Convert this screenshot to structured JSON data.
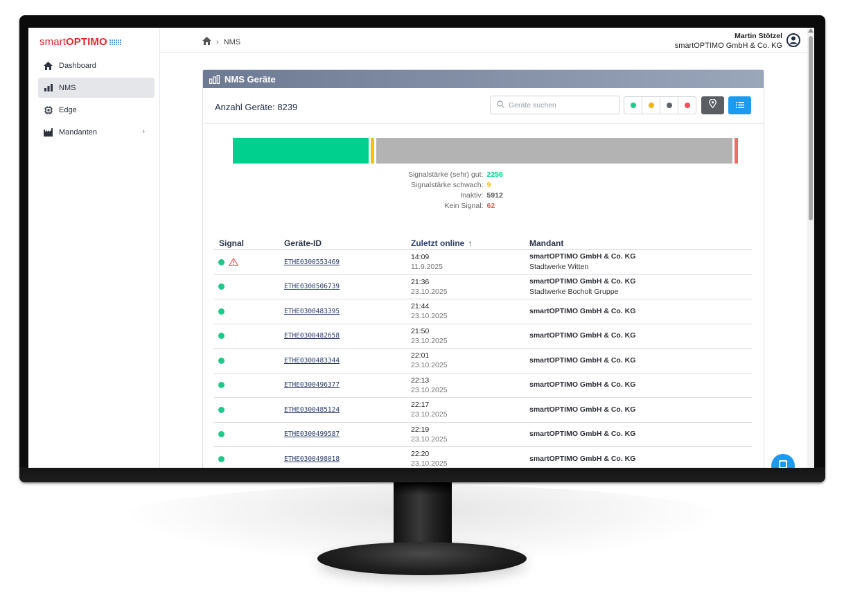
{
  "app": {
    "logo_smart": "smart",
    "logo_optimo": "OPTIMO",
    "brand_color": "#e3262a"
  },
  "sidebar": {
    "items": [
      {
        "label": "Dashboard",
        "icon": "home-icon",
        "active": false
      },
      {
        "label": "NMS",
        "icon": "bar-chart-icon",
        "active": true
      },
      {
        "label": "Edge",
        "icon": "chip-icon",
        "active": false
      },
      {
        "label": "Mandanten",
        "icon": "factory-icon",
        "active": false,
        "has_submenu": true
      }
    ]
  },
  "header": {
    "breadcrumb": [
      "NMS"
    ],
    "user_name": "Martin Stötzel",
    "user_org": "smartOPTIMO GmbH & Co. KG"
  },
  "card": {
    "title": "NMS Geräte",
    "count_label": "Anzahl Geräte: 8239",
    "search_placeholder": "Geräte suchen",
    "filter_colors": [
      "#1ec98a",
      "#f5b400",
      "#5f6368",
      "#f0505a"
    ]
  },
  "signal_summary": [
    {
      "label": "Signalstärke (sehr) gut:",
      "value": 2256,
      "color": "#00d08e"
    },
    {
      "label": "Signalstärke schwach:",
      "value": 9,
      "color": "#f5c000"
    },
    {
      "label": "Inaktiv:",
      "value": 5912,
      "color": "#555555",
      "bar_color": "#b3b3b3"
    },
    {
      "label": "Kein Signal:",
      "value": 62,
      "color": "#f25b5b",
      "bar_color": "#f06b6b"
    }
  ],
  "table": {
    "headers": {
      "signal": "Signal",
      "id": "Geräte-ID",
      "last_online": "Zuletzt online",
      "mandant": "Mandant"
    },
    "sort_indicator": "↑",
    "rows": [
      {
        "id": "ETHE0300553469",
        "time": "14:09",
        "date": "11.9.2025",
        "mandant": "smartOPTIMO GmbH & Co. KG",
        "sub": "Stadtwerke Witten",
        "warning": true
      },
      {
        "id": "ETHE0300506739",
        "time": "21:36",
        "date": "23.10.2025",
        "mandant": "smartOPTIMO GmbH & Co. KG",
        "sub": "Stadtwerke Bocholt Gruppe",
        "warning": false
      },
      {
        "id": "ETHE0300483395",
        "time": "21:44",
        "date": "23.10.2025",
        "mandant": "smartOPTIMO GmbH & Co. KG",
        "sub": "",
        "warning": false
      },
      {
        "id": "ETHE0300482658",
        "time": "21:50",
        "date": "23.10.2025",
        "mandant": "smartOPTIMO GmbH & Co. KG",
        "sub": "",
        "warning": false
      },
      {
        "id": "ETHE0300483344",
        "time": "22:01",
        "date": "23.10.2025",
        "mandant": "smartOPTIMO GmbH & Co. KG",
        "sub": "",
        "warning": false
      },
      {
        "id": "ETHE0300496377",
        "time": "22:13",
        "date": "23.10.2025",
        "mandant": "smartOPTIMO GmbH & Co. KG",
        "sub": "",
        "warning": false
      },
      {
        "id": "ETHE0300485124",
        "time": "22:17",
        "date": "23.10.2025",
        "mandant": "smartOPTIMO GmbH & Co. KG",
        "sub": "",
        "warning": false
      },
      {
        "id": "ETHE0300499587",
        "time": "22:19",
        "date": "23.10.2025",
        "mandant": "smartOPTIMO GmbH & Co. KG",
        "sub": "",
        "warning": false
      },
      {
        "id": "ETHE0300498018",
        "time": "22:20",
        "date": "23.10.2025",
        "mandant": "smartOPTIMO GmbH & Co. KG",
        "sub": "",
        "warning": false
      }
    ]
  }
}
